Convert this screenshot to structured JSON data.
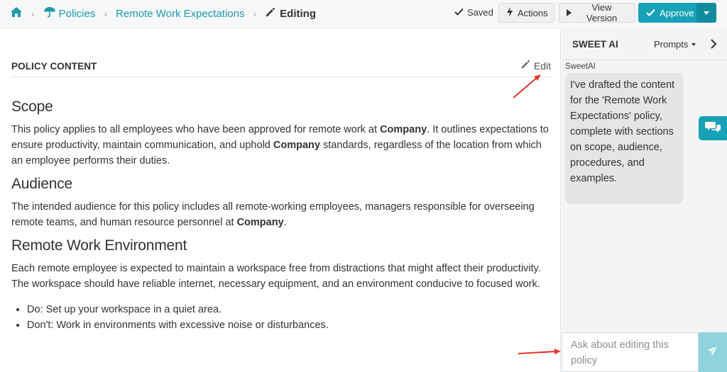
{
  "breadcrumb": {
    "home_icon": "home-icon",
    "policies_icon": "umbrella-icon",
    "items": [
      "Policies",
      "Remote Work Expectations"
    ],
    "current": "Editing",
    "current_icon": "pencil-icon"
  },
  "toolbar": {
    "saved_label": "Saved",
    "actions_label": "Actions",
    "view_version_label": "View Version",
    "approve_label": "Approve"
  },
  "content": {
    "section_title": "POLICY CONTENT",
    "edit_label": "Edit",
    "sections": [
      {
        "heading": "Scope",
        "paragraph": {
          "p1": "This policy applies to all employees who have been approved for remote work at ",
          "b1": "Company",
          "p2": ". It outlines expectations to ensure productivity, maintain communication, and uphold ",
          "b2": "Company",
          "p3": " standards, regardless of the location from which an employee performs their duties."
        }
      },
      {
        "heading": "Audience",
        "paragraph": {
          "p1": "The intended audience for this policy includes all remote-working employees, managers responsible for overseeing remote teams, and human resource personnel at ",
          "b1": "Company",
          "p2": "."
        }
      },
      {
        "heading": "Remote Work Environment",
        "paragraph": "Each remote employee is expected to maintain a workspace free from distractions that might affect their productivity. The workspace should have reliable internet, necessary equipment, and an environment conducive to focused work.",
        "list": [
          "Do: Set up your workspace in a quiet area.",
          "Don't: Work in environments with excessive noise or disturbances."
        ]
      }
    ]
  },
  "ai_panel": {
    "title": "SWEET AI",
    "prompts_label": "Prompts",
    "message": {
      "sender": "SweetAI",
      "text": "I've drafted the content for the 'Remote Work Expectations' policy, complete with sections on scope, audience, procedures, and examples."
    },
    "input_placeholder": "Ask about editing this policy"
  },
  "colors": {
    "accent": "#17a2b8",
    "link": "#1b9aaa",
    "annotation": "#e8322b"
  }
}
